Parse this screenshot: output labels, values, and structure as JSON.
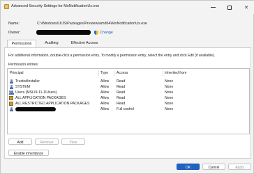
{
  "window": {
    "title": "Advanced Security Settings for MoNotificationUx.exe"
  },
  "info": {
    "name_label": "Name:",
    "name_value": "C:\\Windows\\UUS\\Packages\\Preview\\amd64\\MoNotificationUx.exe",
    "owner_label": "Owner:",
    "change_label": "Change"
  },
  "tabs": [
    {
      "label": "Permissions"
    },
    {
      "label": "Auditing"
    },
    {
      "label": "Effective Access"
    }
  ],
  "permissions": {
    "info_text": "For additional information, double-click a permission entry. To modify a permission entry, select the entry and click Edit (if available).",
    "entries_label": "Permission entries:",
    "columns": {
      "principal": "Principal",
      "type": "Type",
      "access": "Access",
      "inherited": "Inherited from"
    },
    "rows": [
      {
        "principal": "TrustedInstaller",
        "type": "Allow",
        "access": "Read",
        "inherited": "None",
        "icon": "user-icon"
      },
      {
        "principal": "SYSTEM",
        "type": "Allow",
        "access": "Read",
        "inherited": "None",
        "icon": "user-icon"
      },
      {
        "principal": "Users (MSI-I9-11-1\\Users)",
        "type": "Allow",
        "access": "Read",
        "inherited": "None",
        "icon": "group-icon"
      },
      {
        "principal": "ALL APPLICATION PACKAGES",
        "type": "Allow",
        "access": "Read",
        "inherited": "None",
        "icon": "package-icon"
      },
      {
        "principal": "ALL RESTRICTED APPLICATION PACKAGES",
        "type": "Allow",
        "access": "Read",
        "inherited": "None",
        "icon": "package-icon"
      },
      {
        "principal": "",
        "type": "Allow",
        "access": "Full control",
        "inherited": "None",
        "icon": "user-icon"
      }
    ]
  },
  "buttons": {
    "add": "Add",
    "remove": "Remove",
    "view": "View",
    "enable_inheritance": "Enable inheritance",
    "ok": "OK",
    "cancel": "Cancel",
    "apply": "Apply"
  }
}
